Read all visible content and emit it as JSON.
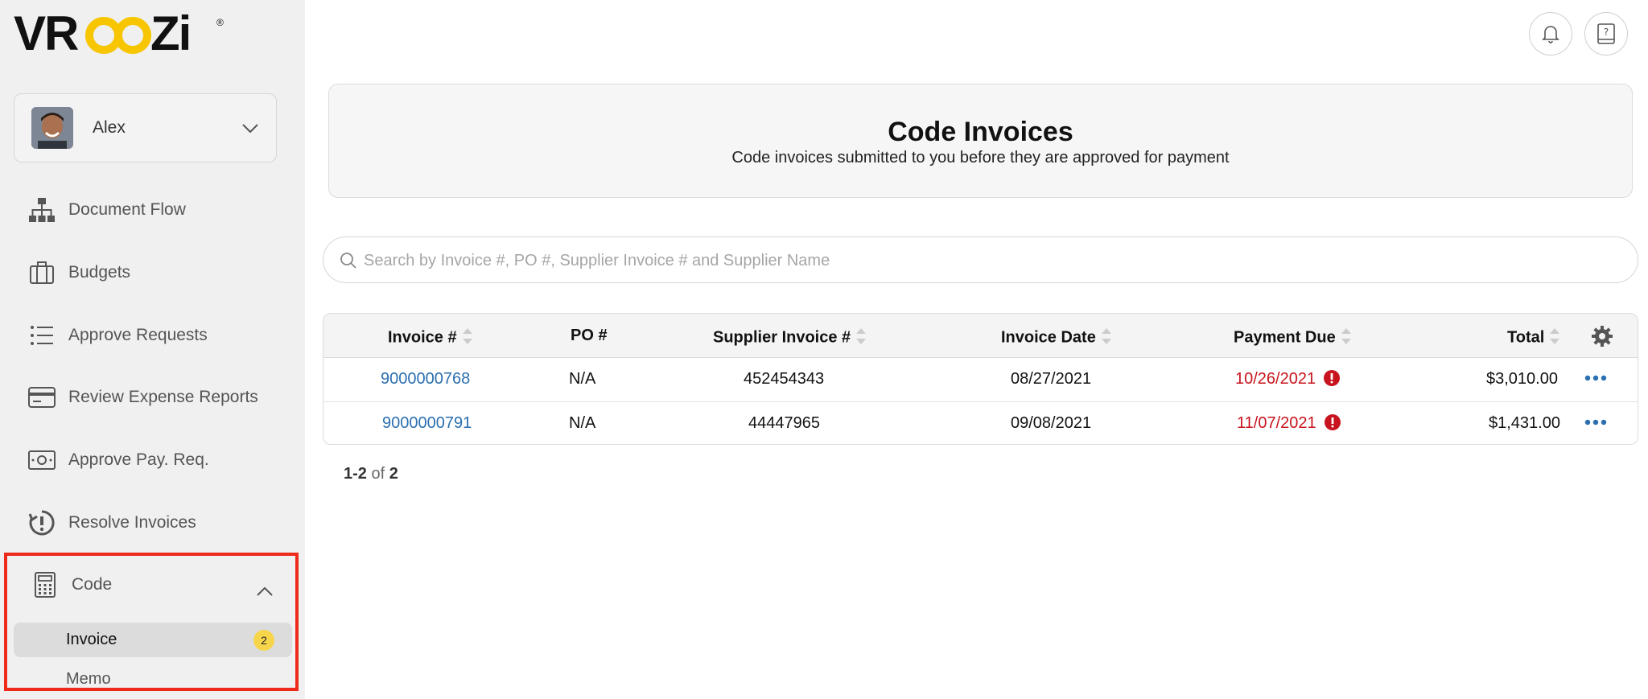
{
  "brand": {
    "logo_text": "VROOZi",
    "accent": "#f7c600"
  },
  "user": {
    "name": "Alex"
  },
  "sidebar": {
    "items": [
      {
        "label": "Document Flow",
        "icon": "sitemap-icon"
      },
      {
        "label": "Budgets",
        "icon": "briefcase-icon"
      },
      {
        "label": "Approve Requests",
        "icon": "list-icon"
      },
      {
        "label": "Review Expense Reports",
        "icon": "credit-card-icon"
      },
      {
        "label": "Approve Pay. Req.",
        "icon": "money-icon"
      },
      {
        "label": "Resolve Invoices",
        "icon": "clock-alert-icon"
      }
    ],
    "code": {
      "label": "Code",
      "icon": "calculator-icon",
      "sub_items": [
        {
          "label": "Invoice",
          "badge": "2",
          "active": true
        },
        {
          "label": "Memo"
        }
      ]
    }
  },
  "topbar": {
    "notifications_icon": "bell-icon",
    "help_icon": "help-book-icon"
  },
  "header": {
    "title": "Code Invoices",
    "subtitle": "Code invoices submitted to you before they are approved for payment"
  },
  "search": {
    "placeholder": "Search by Invoice #, PO #, Supplier Invoice # and Supplier Name",
    "value": ""
  },
  "table": {
    "columns": [
      "Invoice #",
      "PO #",
      "Supplier Invoice #",
      "Invoice Date",
      "Payment Due",
      "Total"
    ],
    "rows": [
      {
        "invoice": "9000000768",
        "po": "N/A",
        "supplier_invoice": "452454343",
        "invoice_date": "08/27/2021",
        "payment_due": "10/26/2021",
        "total": "$3,010.00"
      },
      {
        "invoice": "9000000791",
        "po": "N/A",
        "supplier_invoice": "44447965",
        "invoice_date": "09/08/2021",
        "payment_due": "11/07/2021",
        "total": "$1,431.00"
      }
    ]
  },
  "pagination": {
    "range": "1-2",
    "of_label": "of",
    "total": "2"
  },
  "colors": {
    "link": "#2a6fb0",
    "overdue": "#c8141e",
    "highlight_border": "#ee2a1b",
    "badge": "#f7d54a"
  }
}
